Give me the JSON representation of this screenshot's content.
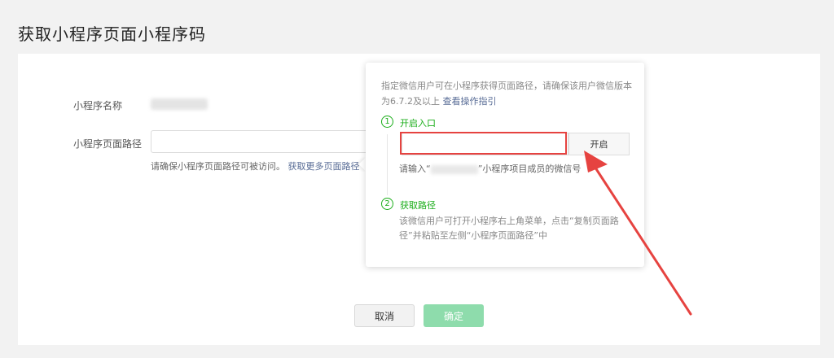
{
  "page": {
    "title": "获取小程序页面小程序码"
  },
  "form": {
    "name_label": "小程序名称",
    "path_label": "小程序页面路径",
    "path_hint": "请确保小程序页面路径可被访问。",
    "path_link": "获取更多页面路径"
  },
  "buttons": {
    "cancel": "取消",
    "confirm": "确定",
    "confirm_color": "#8edcac"
  },
  "popover": {
    "intro": "指定微信用户可在小程序获得页面路径，请确保该用户微信版本为6.7.2及以上",
    "intro_link": "查看操作指引",
    "step1": {
      "number": "1",
      "title": "开启入口",
      "button": "开启",
      "hint_prefix": "请输入“",
      "hint_suffix": "”小程序项目成员的微信号"
    },
    "step2": {
      "number": "2",
      "title": "获取路径",
      "desc": "该微信用户可打开小程序右上角菜单，点击“复制页面路径”并粘贴至左侧“小程序页面路径”中"
    }
  },
  "colors": {
    "brand_green": "#1aad19",
    "link": "#576b95",
    "annotation_red": "#e64340"
  },
  "annotation": {
    "icon": "red-arrow-icon"
  }
}
